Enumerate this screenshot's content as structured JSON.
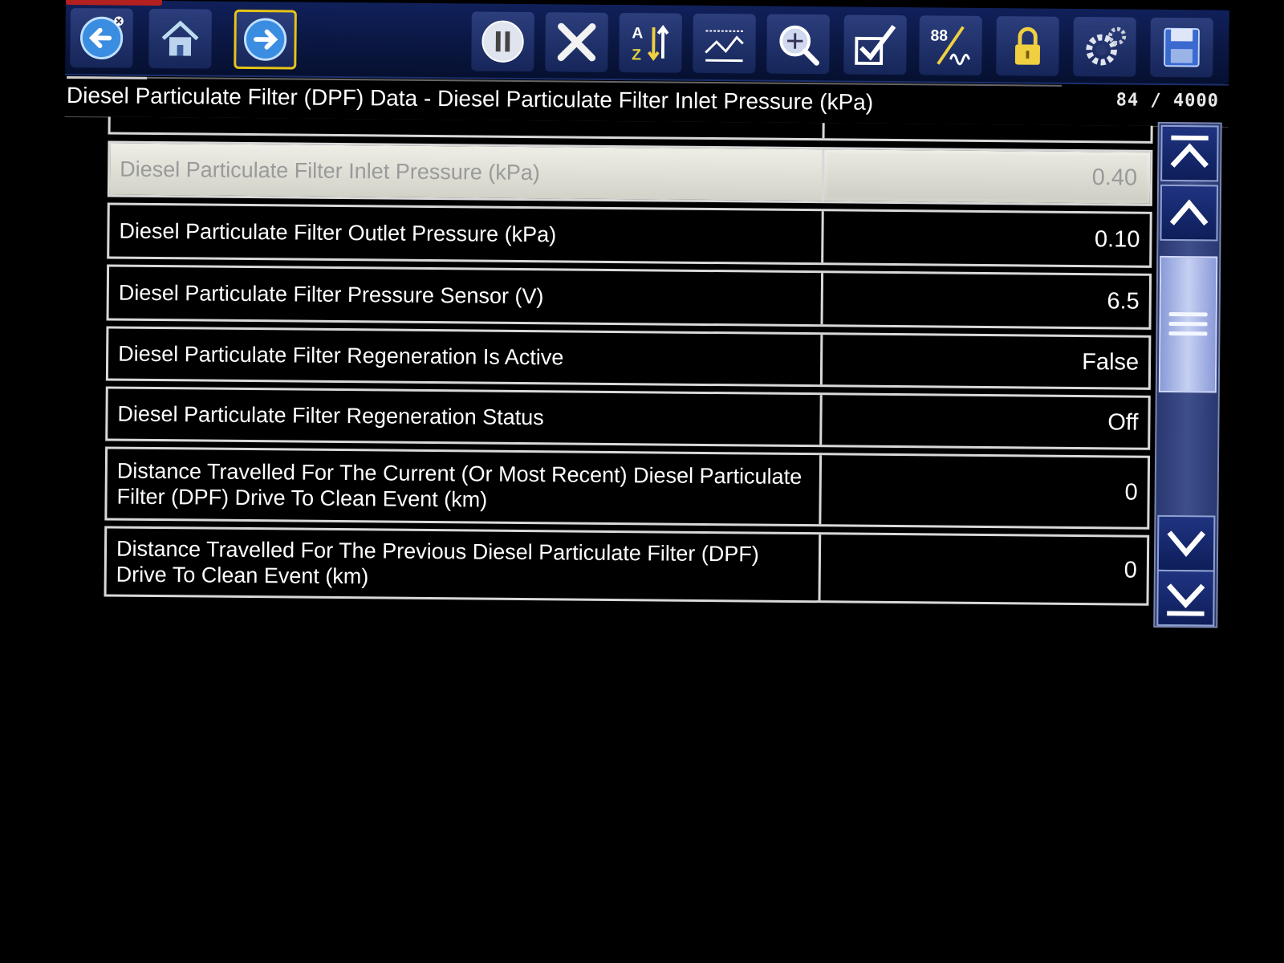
{
  "toolbar": {
    "buttons": [
      {
        "name": "back-button",
        "icon": "back-arrow-icon"
      },
      {
        "name": "home-button",
        "icon": "home-icon"
      },
      {
        "name": "forward-button",
        "icon": "forward-arrow-icon",
        "active": true
      },
      {
        "name": "pause-button",
        "icon": "pause-icon"
      },
      {
        "name": "clear-button",
        "icon": "x-icon"
      },
      {
        "name": "sort-button",
        "icon": "sort-az-icon"
      },
      {
        "name": "graph-view-button",
        "icon": "graph-icon"
      },
      {
        "name": "zoom-button",
        "icon": "magnifier-icon"
      },
      {
        "name": "select-button",
        "icon": "checkmark-icon"
      },
      {
        "name": "units-button",
        "icon": "units-icon",
        "text": "88"
      },
      {
        "name": "lock-button",
        "icon": "lock-icon"
      },
      {
        "name": "settings-button",
        "icon": "gear-icon"
      },
      {
        "name": "save-button",
        "icon": "floppy-disk-icon"
      }
    ]
  },
  "title": "Diesel Particulate Filter (DPF) Data - Diesel Particulate Filter Inlet Pressure (kPa)",
  "page_count": "84 / 4000",
  "rows": [
    {
      "name": "Diesel Particulate Filter Inlet Pressure (kPa)",
      "value": "0.40",
      "selected": true
    },
    {
      "name": "Diesel Particulate Filter Outlet Pressure (kPa)",
      "value": "0.10"
    },
    {
      "name": "Diesel Particulate Filter Pressure Sensor (V)",
      "value": "6.5"
    },
    {
      "name": "Diesel Particulate Filter Regeneration Is Active",
      "value": "False"
    },
    {
      "name": "Diesel Particulate Filter Regeneration Status",
      "value": "Off"
    },
    {
      "name": "Distance Travelled For The Current (Or Most Recent) Diesel Particulate Filter (DPF) Drive To Clean Event (km)",
      "value": "0"
    },
    {
      "name": "Distance Travelled For The Previous Diesel Particulate Filter (DPF) Drive To Clean Event (km)",
      "value": "0"
    }
  ],
  "colors": {
    "toolbar_bg": "#0a1640",
    "active_border": "#e6c419",
    "row_border": "#d8d8d8",
    "selected_row": "#e0e0d8"
  }
}
